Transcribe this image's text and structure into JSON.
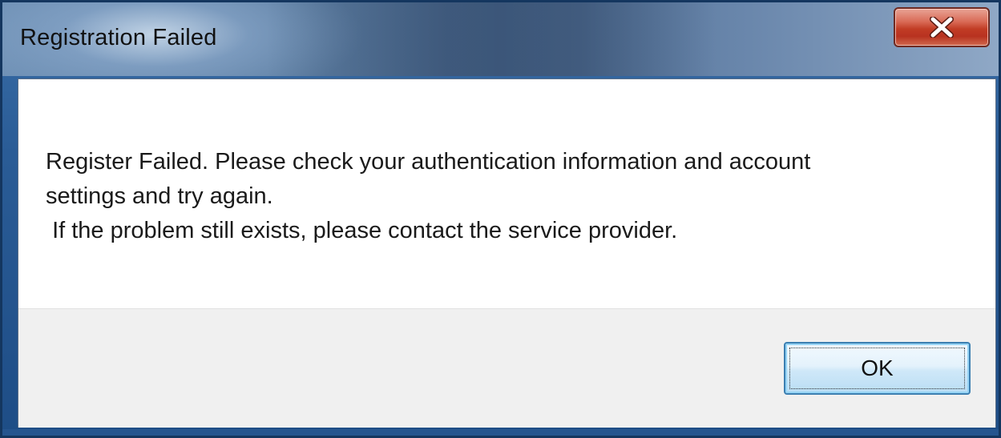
{
  "window": {
    "title": "Registration Failed",
    "close_icon": "close-x-icon"
  },
  "message": {
    "text": "Register Failed. Please check your authentication information and account\nsettings and try again.\n If the problem still exists, please contact the service provider."
  },
  "buttons": {
    "ok_label": "OK"
  },
  "colors": {
    "close_button": "#c13c25",
    "ok_border": "#3c7fb1",
    "content_bg": "#ffffff",
    "footer_bg": "#f0f0f0"
  }
}
